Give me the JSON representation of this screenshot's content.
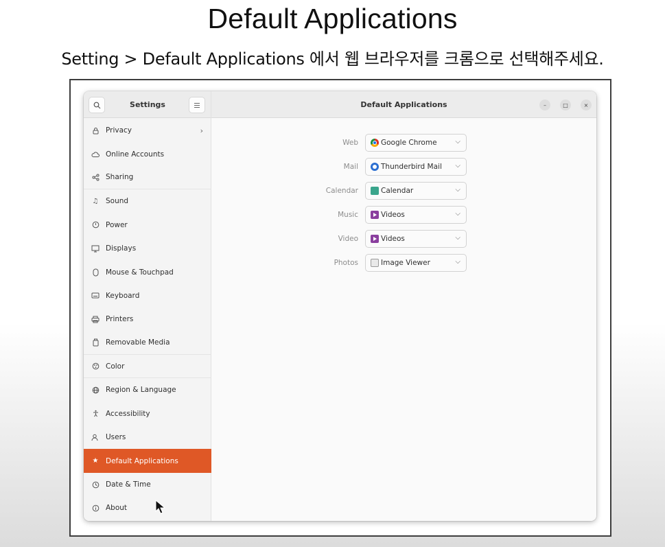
{
  "slide": {
    "title": "Default Applications",
    "subtitle": "Setting > Default Applications 에서 웹 브라우저를 크롬으로 선택해주세요."
  },
  "window": {
    "sidebar_title": "Settings",
    "content_title": "Default Applications"
  },
  "sidebar": {
    "items": [
      {
        "label": "Privacy",
        "icon": "lock-icon"
      },
      {
        "label": "Online Accounts",
        "icon": "cloud-icon"
      },
      {
        "label": "Sharing",
        "icon": "share-icon"
      },
      {
        "label": "Sound",
        "icon": "music-note-icon"
      },
      {
        "label": "Power",
        "icon": "power-icon"
      },
      {
        "label": "Displays",
        "icon": "display-icon"
      },
      {
        "label": "Mouse & Touchpad",
        "icon": "mouse-icon"
      },
      {
        "label": "Keyboard",
        "icon": "keyboard-icon"
      },
      {
        "label": "Printers",
        "icon": "printer-icon"
      },
      {
        "label": "Removable Media",
        "icon": "usb-drive-icon"
      },
      {
        "label": "Color",
        "icon": "palette-icon"
      },
      {
        "label": "Region & Language",
        "icon": "globe-icon"
      },
      {
        "label": "Accessibility",
        "icon": "accessibility-icon"
      },
      {
        "label": "Users",
        "icon": "users-icon"
      },
      {
        "label": "Default Applications",
        "icon": "star-icon",
        "active": true
      },
      {
        "label": "Date & Time",
        "icon": "clock-icon"
      },
      {
        "label": "About",
        "icon": "info-icon"
      }
    ]
  },
  "defaults": {
    "rows": [
      {
        "label": "Web",
        "value": "Google Chrome",
        "icon": "chrome-icon"
      },
      {
        "label": "Mail",
        "value": "Thunderbird Mail",
        "icon": "thunderbird-icon"
      },
      {
        "label": "Calendar",
        "value": "Calendar",
        "icon": "calendar-app-icon"
      },
      {
        "label": "Music",
        "value": "Videos",
        "icon": "videos-app-icon"
      },
      {
        "label": "Video",
        "value": "Videos",
        "icon": "videos-app-icon"
      },
      {
        "label": "Photos",
        "value": "Image Viewer",
        "icon": "image-viewer-icon"
      }
    ]
  },
  "colors": {
    "accent": "#df5826"
  }
}
